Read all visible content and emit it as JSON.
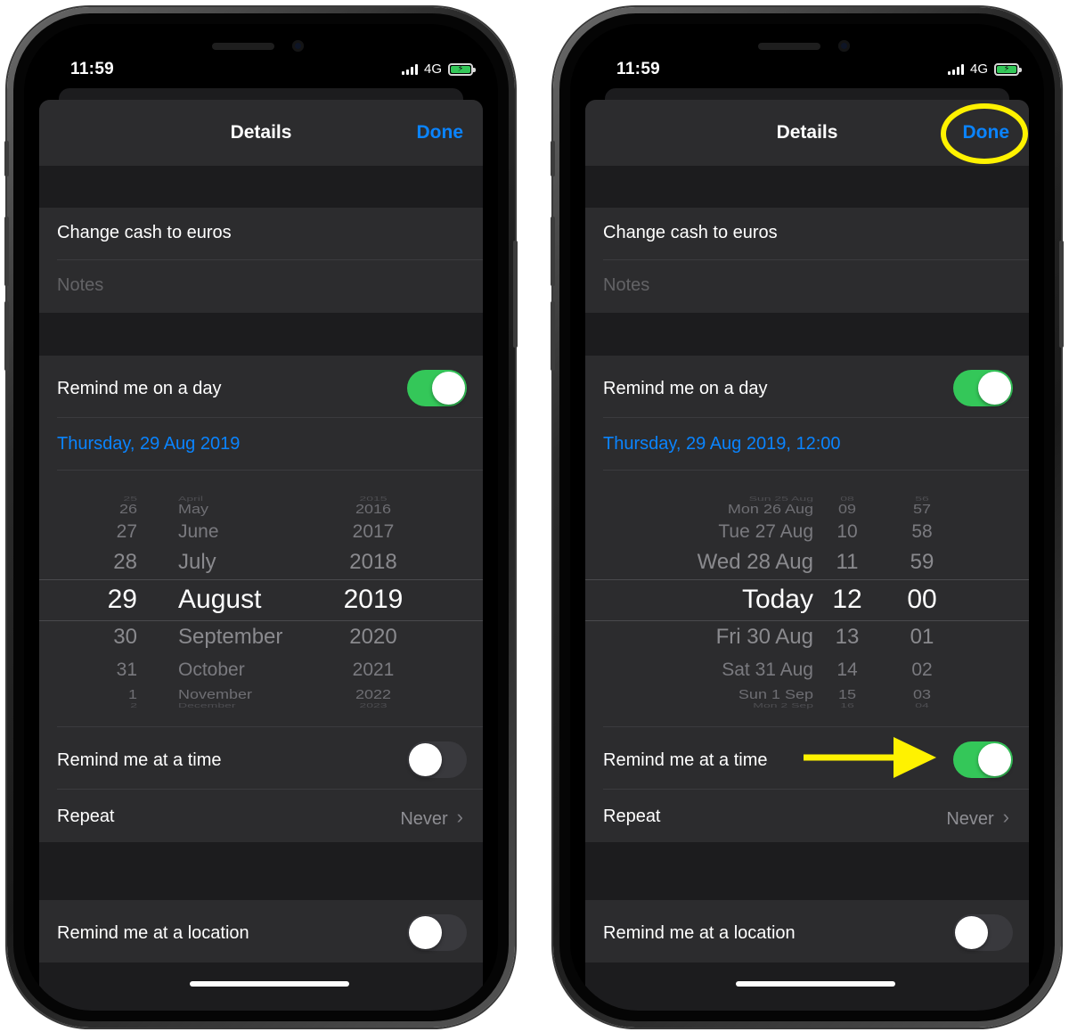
{
  "colors": {
    "accent": "#0a84ff",
    "toggle_on": "#34c759",
    "annotation": "#fff200",
    "background": "#1c1c1e",
    "cell": "#2c2c2e"
  },
  "icons": {
    "disclosure": "chevron-right-icon",
    "battery": "battery-charging-icon",
    "signal": "cellular-signal-icon"
  },
  "phones": [
    {
      "status": {
        "time": "11:59",
        "network": "4G"
      },
      "nav": {
        "title": "Details",
        "done": "Done"
      },
      "task": {
        "title": "Change cash to euros",
        "notes_placeholder": "Notes"
      },
      "remind_day": {
        "label": "Remind me on a day",
        "on": true,
        "date": "Thursday, 29 Aug 2019"
      },
      "picker": {
        "columns": [
          {
            "items": [
              "25",
              "26",
              "27",
              "28",
              "29",
              "30",
              "31",
              "1",
              "2"
            ]
          },
          {
            "items": [
              "April",
              "May",
              "June",
              "July",
              "August",
              "September",
              "October",
              "November",
              "December"
            ]
          },
          {
            "items": [
              "2015",
              "2016",
              "2017",
              "2018",
              "2019",
              "2020",
              "2021",
              "2022",
              "2023"
            ]
          }
        ]
      },
      "remind_time": {
        "label": "Remind me at a time",
        "on": false
      },
      "repeat": {
        "label": "Repeat",
        "value": "Never"
      },
      "remind_location": {
        "label": "Remind me at a location",
        "on": false
      }
    },
    {
      "status": {
        "time": "11:59",
        "network": "4G"
      },
      "nav": {
        "title": "Details",
        "done": "Done"
      },
      "task": {
        "title": "Change cash to euros",
        "notes_placeholder": "Notes"
      },
      "remind_day": {
        "label": "Remind me on a day",
        "on": true,
        "date": "Thursday, 29 Aug 2019, 12:00"
      },
      "picker": {
        "columns": [
          {
            "items": [
              "Sun 25 Aug",
              "Mon 26 Aug",
              "Tue 27 Aug",
              "Wed 28 Aug",
              "Today",
              "Fri 30 Aug",
              "Sat 31 Aug",
              "Sun 1 Sep",
              "Mon 2 Sep"
            ]
          },
          {
            "items": [
              "08",
              "09",
              "10",
              "11",
              "12",
              "13",
              "14",
              "15",
              "16"
            ]
          },
          {
            "items": [
              "56",
              "57",
              "58",
              "59",
              "00",
              "01",
              "02",
              "03",
              "04"
            ]
          }
        ]
      },
      "remind_time": {
        "label": "Remind me at a time",
        "on": true
      },
      "repeat": {
        "label": "Repeat",
        "value": "Never"
      },
      "remind_location": {
        "label": "Remind me at a location",
        "on": false
      }
    }
  ]
}
